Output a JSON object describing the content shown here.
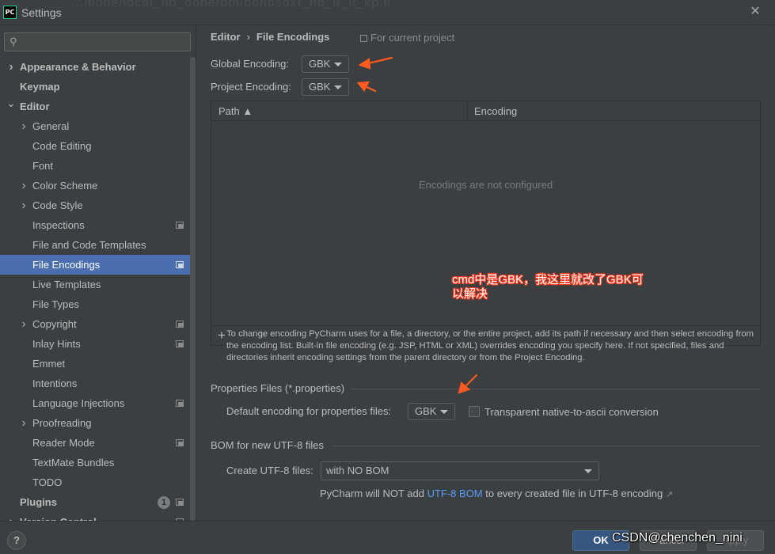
{
  "window": {
    "title": "Settings",
    "faint_background_text": "...mode/local_hb_done/bbl/bonosdxt_hb_it_it_kp.il"
  },
  "sidebar": {
    "search_placeholder": "",
    "items": [
      {
        "label": "Appearance & Behavior",
        "level": 0,
        "bold": true,
        "chevron": "right"
      },
      {
        "label": "Keymap",
        "level": 0,
        "bold": true
      },
      {
        "label": "Editor",
        "level": 0,
        "bold": true,
        "chevron": "down"
      },
      {
        "label": "General",
        "level": 1,
        "chevron": "right"
      },
      {
        "label": "Code Editing",
        "level": 1
      },
      {
        "label": "Font",
        "level": 1
      },
      {
        "label": "Color Scheme",
        "level": 1,
        "chevron": "right"
      },
      {
        "label": "Code Style",
        "level": 1,
        "chevron": "right"
      },
      {
        "label": "Inspections",
        "level": 1,
        "project_icon": true
      },
      {
        "label": "File and Code Templates",
        "level": 1
      },
      {
        "label": "File Encodings",
        "level": 1,
        "project_icon": true,
        "selected": true
      },
      {
        "label": "Live Templates",
        "level": 1
      },
      {
        "label": "File Types",
        "level": 1
      },
      {
        "label": "Copyright",
        "level": 1,
        "chevron": "right",
        "project_icon": true
      },
      {
        "label": "Inlay Hints",
        "level": 1,
        "project_icon": true
      },
      {
        "label": "Emmet",
        "level": 1
      },
      {
        "label": "Intentions",
        "level": 1
      },
      {
        "label": "Language Injections",
        "level": 1,
        "project_icon": true
      },
      {
        "label": "Proofreading",
        "level": 1,
        "chevron": "right"
      },
      {
        "label": "Reader Mode",
        "level": 1,
        "project_icon": true
      },
      {
        "label": "TextMate Bundles",
        "level": 1
      },
      {
        "label": "TODO",
        "level": 1
      },
      {
        "label": "Plugins",
        "level": 0,
        "bold": true,
        "badge": "1",
        "project_icon": true
      },
      {
        "label": "Version Control",
        "level": 0,
        "bold": true,
        "chevron": "right",
        "project_icon": true
      }
    ]
  },
  "main": {
    "breadcrumb": {
      "parent": "Editor",
      "separator": "›",
      "current": "File Encodings"
    },
    "for_current_project": "For current project",
    "global_encoding": {
      "label": "Global Encoding:",
      "value": "GBK"
    },
    "project_encoding": {
      "label": "Project Encoding:",
      "value": "GBK"
    },
    "table": {
      "columns": [
        "Path ▲",
        "Encoding"
      ],
      "empty_text": "Encodings are not configured",
      "toolbar": {
        "add": "+",
        "remove": "−",
        "edit": "✎"
      }
    },
    "description": "To change encoding PyCharm uses for a file, a directory, or the entire project, add its path if necessary and then select encoding from the encoding list. Built-in file encoding (e.g. JSP, HTML or XML) overrides encoding you specify here. If not specified, files and directories inherit encoding settings from the parent directory or from the Project Encoding.",
    "properties": {
      "section_title": "Properties Files (*.properties)",
      "default_label": "Default encoding for properties files:",
      "default_value": "GBK",
      "transparent_label": "Transparent native-to-ascii conversion",
      "transparent_checked": false
    },
    "bom": {
      "section_title": "BOM for new UTF-8 files",
      "create_label": "Create UTF-8 files:",
      "create_value": "with NO BOM",
      "note_prefix": "PyCharm will NOT add ",
      "note_link": "UTF-8 BOM",
      "note_suffix": " to every created file in UTF-8 encoding",
      "note_arrow": "↗"
    },
    "annotation": {
      "line1": "cmd中是GBK，我这里就改了GBK可",
      "line2": "以解决",
      "color": "#ff3b1f"
    }
  },
  "footer": {
    "help": "?",
    "ok": "OK",
    "cancel": "Cancel",
    "apply": "Apply",
    "watermark": "CSDN@chenchen_nini"
  },
  "colors": {
    "background": "#3c3f41",
    "selection": "#4b6eaf",
    "link": "#589df6",
    "primary_button": "#365880",
    "annotation_arrow": "#ff5a1f"
  }
}
